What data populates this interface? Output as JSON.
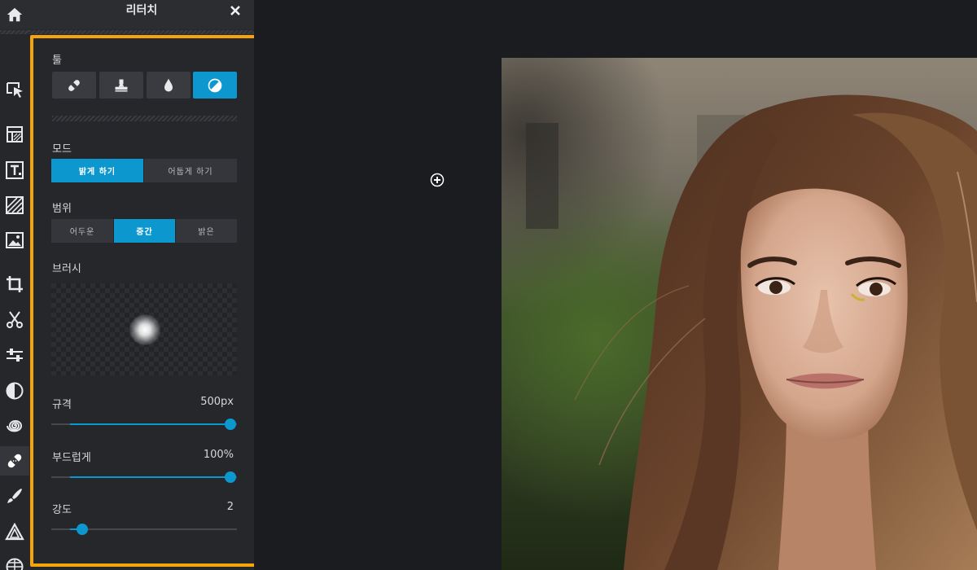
{
  "panel": {
    "title": "리터치",
    "tools_label": "툴",
    "tools": [
      {
        "name": "bandage",
        "icon": "bandage-icon",
        "active": false
      },
      {
        "name": "stamp",
        "icon": "stamp-icon",
        "active": false
      },
      {
        "name": "blur-drop",
        "icon": "drop-icon",
        "active": false
      },
      {
        "name": "dodge-burn",
        "icon": "contrast-circle-icon",
        "active": true
      }
    ],
    "mode_label": "모드",
    "mode_options": [
      "밝게 하기",
      "어둡게 하기"
    ],
    "mode_selected": "밝게 하기",
    "range_label": "범위",
    "range_options": [
      "어두운",
      "중간",
      "밝은"
    ],
    "range_selected": "중간",
    "brush_label": "브러시",
    "size_label": "규격",
    "size_value": "500px",
    "size_fraction": 1.0,
    "softness_label": "부드럽게",
    "softness_value": "100%",
    "softness_fraction": 1.0,
    "strength_label": "강도",
    "strength_value": "2",
    "strength_fraction": 0.14
  },
  "toolbar": {
    "items": [
      "home-icon",
      "select-arrow-icon",
      "layers-icon",
      "text-icon",
      "pattern-icon",
      "image-icon",
      "crop-icon",
      "scissors-icon",
      "adjust-sliders-icon",
      "contrast-icon",
      "spiral-icon",
      "bandage-icon",
      "brush-icon",
      "triangle-icon",
      "grid-sphere-icon"
    ],
    "active": "bandage-icon"
  },
  "colors": {
    "accent": "#0c97cf",
    "highlight": "#f5a50a",
    "panel_bg": "#25272b",
    "canvas_bg": "#1b1c1f"
  }
}
